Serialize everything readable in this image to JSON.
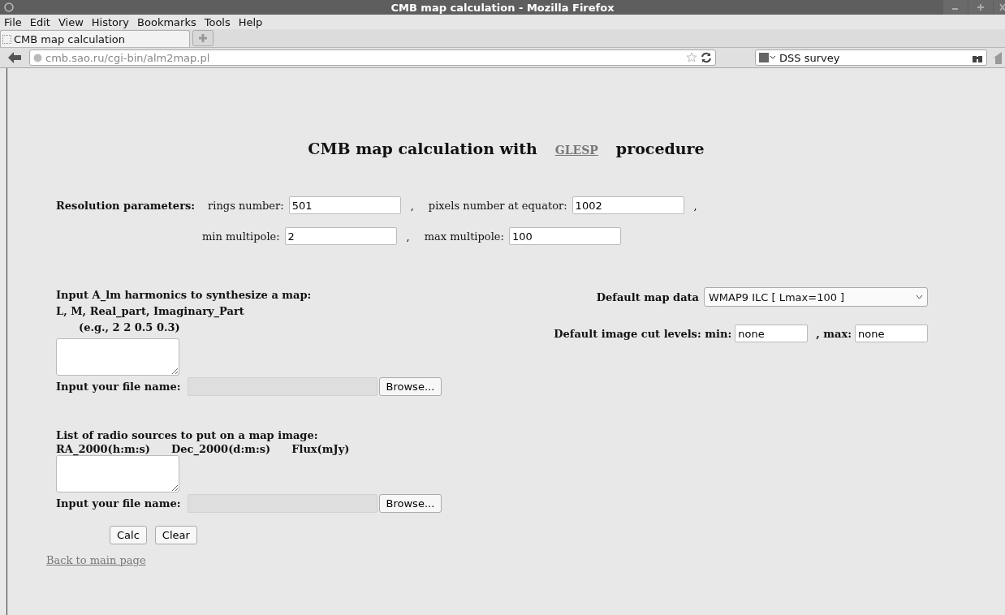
{
  "window": {
    "title": "CMB map calculation - Mozilla Firefox"
  },
  "menu": [
    "File",
    "Edit",
    "View",
    "History",
    "Bookmarks",
    "Tools",
    "Help"
  ],
  "tabs": [
    {
      "label": "CMB map calculation",
      "selected": true
    }
  ],
  "address_bar": {
    "url": "cmb.sao.ru/cgi-bin/alm2map.pl"
  },
  "search_bar": {
    "value": "DSS survey"
  },
  "page": {
    "heading": {
      "text_before": "CMB map calculation with",
      "link": "GLESP",
      "text_after": "procedure"
    },
    "resolution": {
      "label": "Resolution parameters:",
      "rows": [
        {
          "fields": [
            {
              "label": "rings number:",
              "value": "501",
              "separator": ","
            },
            {
              "label": "pixels number at equator:",
              "value": "1002",
              "separator": ","
            }
          ]
        },
        {
          "fields": [
            {
              "label": "min multipole:",
              "value": "2",
              "separator": ","
            },
            {
              "label": "max multipole:",
              "value": "100"
            }
          ]
        }
      ]
    },
    "harmonics": {
      "lines": [
        "Input A_lm harmonics to synthesize a map:",
        "L, M, Real_part, Imaginary_Part",
        "(e.g., 2 2 0.5 0.3)"
      ],
      "file_label": "Input your file name:",
      "browse": "Browse..."
    },
    "map_data": {
      "label": "Default map data",
      "value": "WMAP9 ILC [ Lmax=100 ]"
    },
    "cut_levels": {
      "label": "Default image cut levels: min:",
      "min": "none",
      "max_label": ", max:",
      "max": "none"
    },
    "sources": {
      "title": "List of radio sources to put on a map image:",
      "columns": [
        "RA_2000(h:m:s)",
        "Dec_2000(d:m:s)",
        "Flux(mJy)"
      ],
      "file_label": "Input your file name:",
      "browse": "Browse..."
    },
    "buttons": [
      "Calc",
      "Clear"
    ],
    "back_link": "Back to main page"
  }
}
